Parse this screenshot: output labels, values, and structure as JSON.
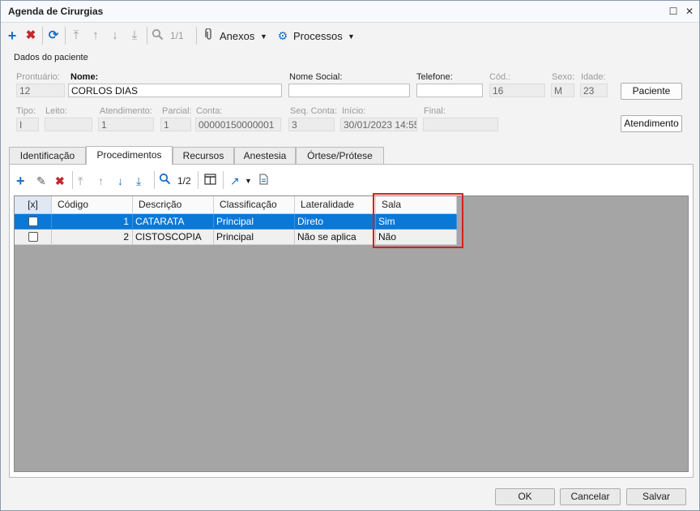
{
  "window": {
    "title": "Agenda de Cirurgias",
    "restore_glyph": "☐",
    "close_glyph": "✕"
  },
  "toolbar": {
    "icons": {
      "add": "add-icon",
      "delete": "delete-icon",
      "refresh": "refresh-icon",
      "first": "first-icon",
      "prev": "prev-icon",
      "next": "next-icon",
      "last": "last-icon",
      "search": "search-icon",
      "clip": "paperclip-icon",
      "gear": "gear-icon"
    },
    "record_counter": "1/1",
    "attachments_label": "Anexos",
    "processes_label": "Processos"
  },
  "patient": {
    "section_title": "Dados do paciente",
    "labels": {
      "prontuario": "Prontuário:",
      "nome": "Nome:",
      "nome_social": "Nome Social:",
      "telefone": "Telefone:",
      "cod": "Cód.:",
      "sexo": "Sexo:",
      "idade": "Idade:",
      "tipo": "Tipo:",
      "leito": "Leito:",
      "atendimento": "Atendimento:",
      "parcial": "Parcial:",
      "conta": "Conta:",
      "seq_conta": "Seq. Conta:",
      "inicio": "Início:",
      "final": "Final:"
    },
    "values": {
      "prontuario": "12",
      "nome": "CORLOS DIAS",
      "nome_social": "",
      "telefone": "",
      "cod": "16",
      "sexo": "M",
      "idade": "23",
      "tipo": "I",
      "leito": "",
      "atendimento": "1",
      "parcial": "1",
      "conta": "00000150000001",
      "seq_conta": "3",
      "inicio": "30/01/2023 14:55",
      "final": ""
    },
    "buttons": {
      "paciente": "Paciente",
      "atendimento": "Atendimento"
    }
  },
  "tabs": [
    "Identificação",
    "Procedimentos",
    "Recursos",
    "Anestesia",
    "Órtese/Prótese"
  ],
  "active_tab": "Procedimentos",
  "proc_toolbar": {
    "record_counter": "1/2"
  },
  "grid": {
    "columns": [
      "[x]",
      "Código",
      "Descrição",
      "Classificação",
      "Lateralidade",
      "Sala Padronizada"
    ],
    "rows": [
      {
        "checked": false,
        "codigo": "1",
        "descricao": "CATARATA",
        "classificacao": "Principal",
        "lateralidade": "Direto",
        "sala_padronizada": "Sim",
        "selected": true
      },
      {
        "checked": false,
        "codigo": "2",
        "descricao": "CISTOSCOPIA",
        "classificacao": "Principal",
        "lateralidade": "Não se aplica",
        "sala_padronizada": "Não",
        "selected": false
      }
    ]
  },
  "footer": {
    "ok": "OK",
    "cancel": "Cancelar",
    "save": "Salvar"
  },
  "colors": {
    "accent_blue": "#0a78d7",
    "icon_blue": "#1a6fc4",
    "delete_red": "#c4262e",
    "highlight_red": "#d42020"
  }
}
